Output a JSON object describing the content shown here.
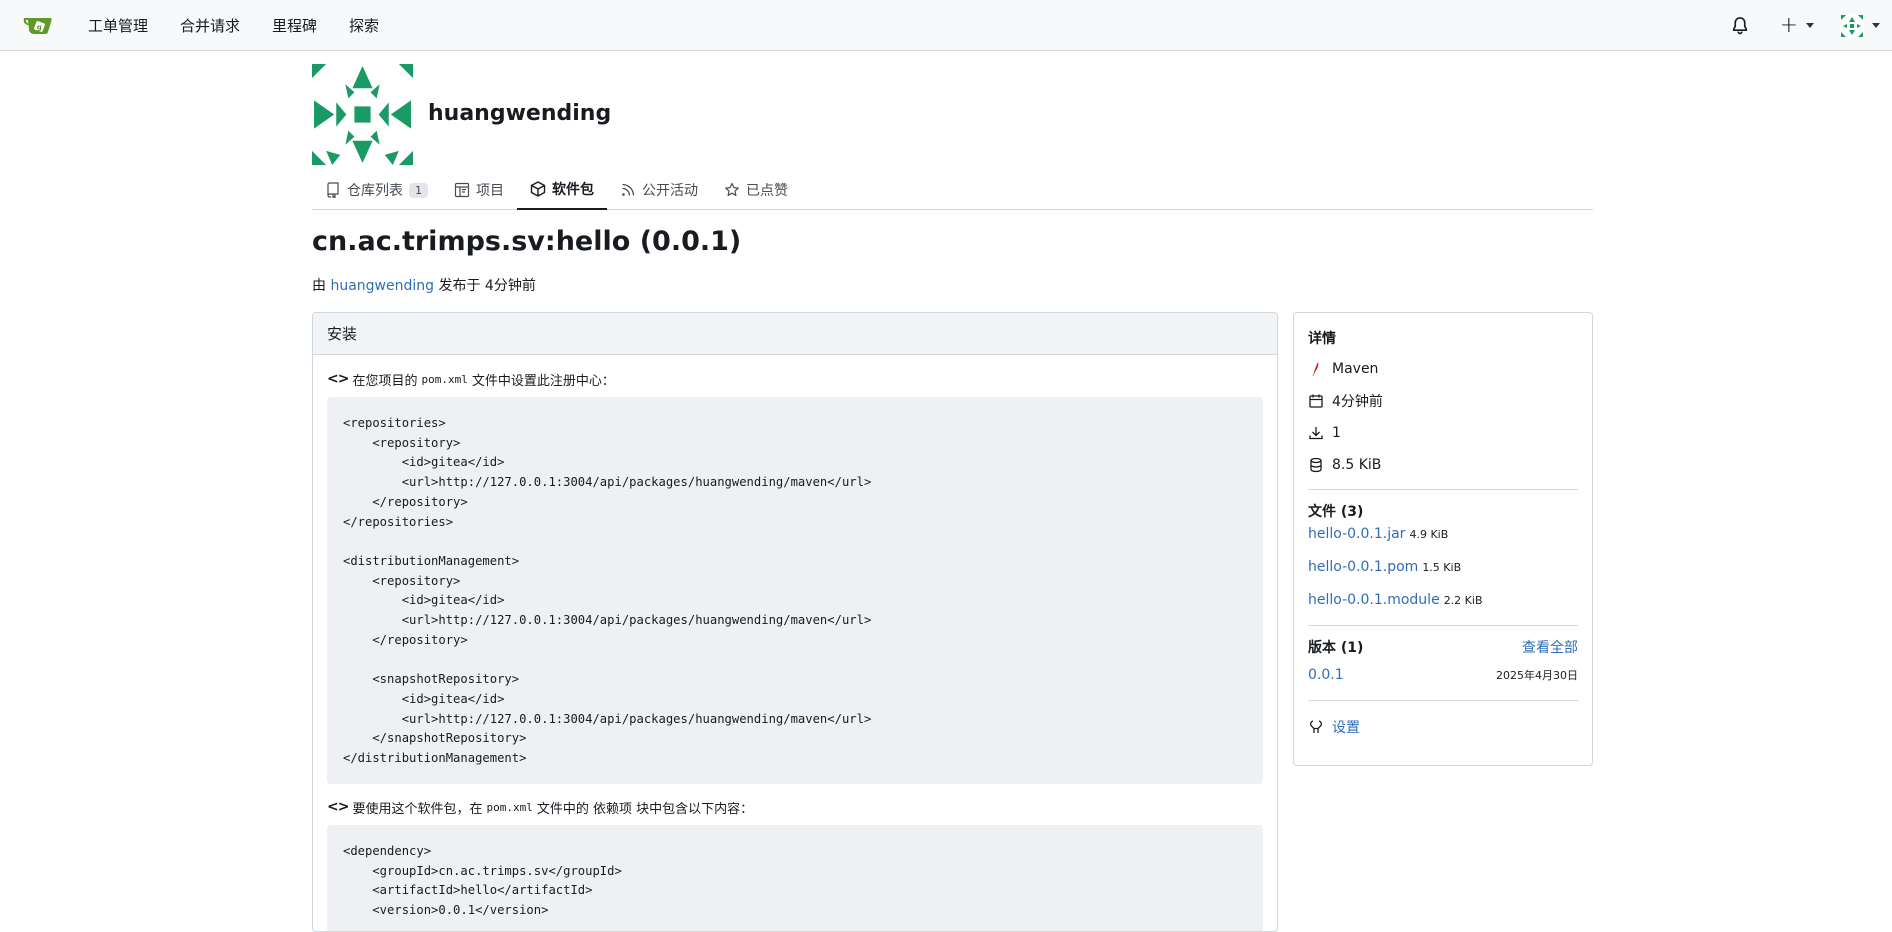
{
  "navbar": {
    "logo": "gitea-logo-icon",
    "items": [
      "工单管理",
      "合并请求",
      "里程碑",
      "探索"
    ],
    "plus_label": "+",
    "icons": [
      "bell-icon",
      "plus-icon",
      "avatar"
    ]
  },
  "profile": {
    "name": "huangwending"
  },
  "tabs": [
    {
      "label": "仓库列表",
      "badge": "1",
      "icon": "repo-icon"
    },
    {
      "label": "项目",
      "icon": "project-icon"
    },
    {
      "label": "软件包",
      "icon": "package-icon",
      "active": true
    },
    {
      "label": "公开活动",
      "icon": "rss-icon"
    },
    {
      "label": "已点赞",
      "icon": "star-icon"
    }
  ],
  "package": {
    "title": "cn.ac.trimps.sv:hello (0.0.1)",
    "meta_prefix": "由",
    "meta_user": "huangwending",
    "meta_suffix": "发布于 4分钟前"
  },
  "install": {
    "heading": "安装",
    "step1_prefix": "在您项目的",
    "step1_file": "pom.xml",
    "step1_suffix": "文件中设置此注册中心：",
    "code1": "<repositories>\n    <repository>\n        <id>gitea</id>\n        <url>http://127.0.0.1:3004/api/packages/huangwending/maven</url>\n    </repository>\n</repositories>\n\n<distributionManagement>\n    <repository>\n        <id>gitea</id>\n        <url>http://127.0.0.1:3004/api/packages/huangwending/maven</url>\n    </repository>\n\n    <snapshotRepository>\n        <id>gitea</id>\n        <url>http://127.0.0.1:3004/api/packages/huangwending/maven</url>\n    </snapshotRepository>\n</distributionManagement>",
    "step2_prefix": "要使用这个软件包，在",
    "step2_file": "pom.xml",
    "step2_suffix": "文件中的 依赖项 块中包含以下内容：",
    "code2": "<dependency>\n    <groupId>cn.ac.trimps.sv</groupId>\n    <artifactId>hello</artifactId>\n    <version>0.0.1</version>"
  },
  "details": {
    "heading": "详情",
    "type": "Maven",
    "published": "4分钟前",
    "downloads": "1",
    "size": "8.5 KiB",
    "files_heading": "文件 (3)",
    "files": [
      {
        "name": "hello-0.0.1.jar",
        "size": "4.9 KiB"
      },
      {
        "name": "hello-0.0.1.pom",
        "size": "1.5 KiB"
      },
      {
        "name": "hello-0.0.1.module",
        "size": "2.2 KiB"
      }
    ],
    "versions_heading": "版本 (1)",
    "view_all": "查看全部",
    "versions": [
      {
        "version": "0.0.1",
        "date": "2025年4月30日"
      }
    ],
    "settings": "设置"
  },
  "colors": {
    "brand_green": "#609926",
    "link": "#2f6eb6",
    "avatar_green": "#1a9a64"
  }
}
